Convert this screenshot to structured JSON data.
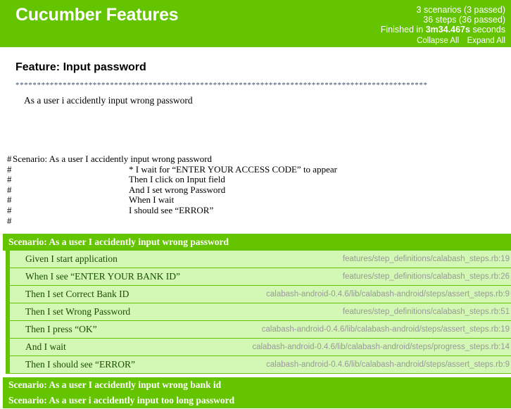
{
  "header": {
    "title": "Cucumber Features",
    "scenarios_line": "3 scenarios (3 passed)",
    "steps_line": "36 steps (36 passed)",
    "finished_prefix": "Finished in ",
    "duration": "3m34.467s",
    "finished_suffix": " seconds",
    "collapse_all": "Collapse All",
    "expand_all": "Expand All",
    "accent_color": "#65c400",
    "text_color": "#ffffff"
  },
  "feature": {
    "heading": "Feature: Input password",
    "rule": "************************************************************************************************",
    "narrative": "As a user i accidently input wrong password"
  },
  "comment_block": {
    "lines": [
      {
        "hash": "#",
        "indent": false,
        "text": "Scenario: As a user I accidently input wrong password"
      },
      {
        "hash": "#",
        "indent": true,
        "text": "* I wait for “ENTER YOUR ACCESS CODE” to appear"
      },
      {
        "hash": "#",
        "indent": true,
        "text": "Then I click on Input field"
      },
      {
        "hash": "#",
        "indent": true,
        "text": "And I set wrong Password"
      },
      {
        "hash": "#",
        "indent": true,
        "text": "When I wait"
      },
      {
        "hash": "#",
        "indent": true,
        "text": "I should see “ERROR”"
      },
      {
        "hash": "#",
        "indent": false,
        "text": ""
      }
    ]
  },
  "scenarios": [
    {
      "name": "Scenario: As a user I accidently input wrong password",
      "expanded": true,
      "steps": [
        {
          "name": "Given I start application",
          "source": "features/step_definitions/calabash_steps.rb:19"
        },
        {
          "name": "When I see “ENTER YOUR BANK ID”",
          "source": "features/step_definitions/calabash_steps.rb:26"
        },
        {
          "name": "Then I set Correct Bank ID",
          "source": "calabash-android-0.4.6/lib/calabash-android/steps/assert_steps.rb:9"
        },
        {
          "name": "Then I set Wrong Password",
          "source": "features/step_definitions/calabash_steps.rb:51"
        },
        {
          "name": "Then I press “OK”",
          "source": "calabash-android-0.4.6/lib/calabash-android/steps/assert_steps.rb:19"
        },
        {
          "name": "And I wait",
          "source": "calabash-android-0.4.6/lib/calabash-android/steps/progress_steps.rb:14"
        },
        {
          "name": "Then I should see “ERROR”",
          "source": "calabash-android-0.4.6/lib/calabash-android/steps/assert_steps.rb:9"
        }
      ]
    },
    {
      "name": "Scenario: As a user I accidently input wrong bank id",
      "expanded": false,
      "steps": []
    },
    {
      "name": "Scenario: As a user i accidently input too long password",
      "expanded": false,
      "steps": []
    }
  ],
  "colors": {
    "passed_green": "#65c400",
    "step_background": "#d3f7b4",
    "step_text": "#1a4f00",
    "source_text": "#999999"
  }
}
